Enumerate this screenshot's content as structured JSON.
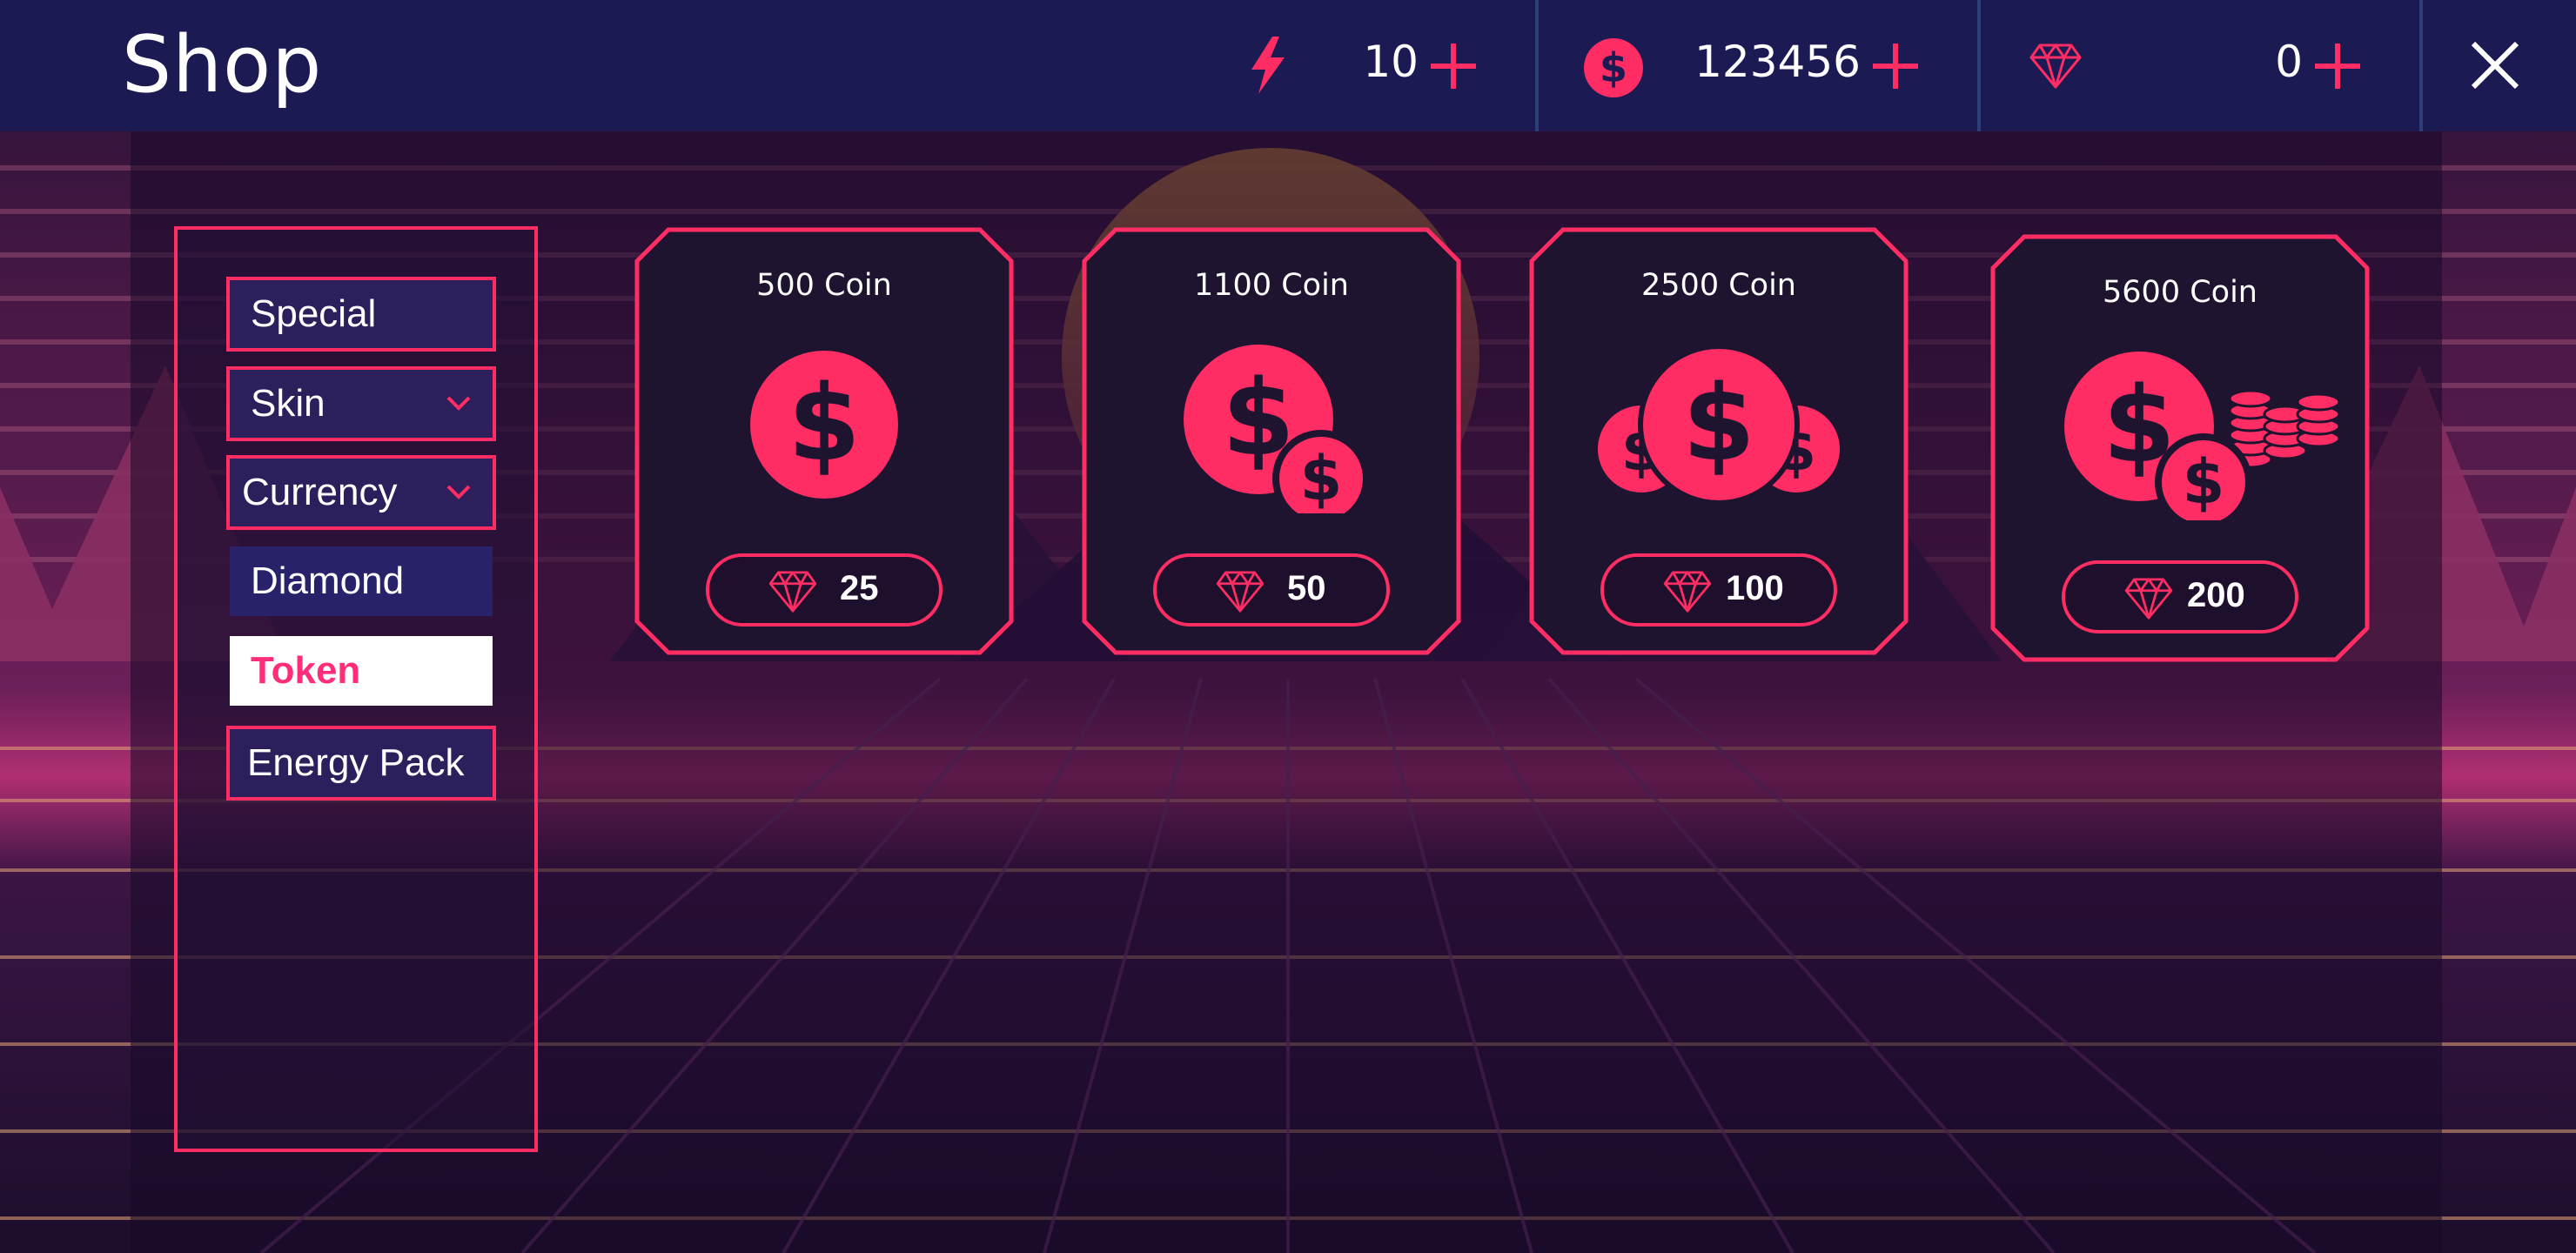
{
  "title": "Shop",
  "resources": [
    {
      "name": "energy",
      "icon": "lightning-icon",
      "value": "10"
    },
    {
      "name": "coins",
      "icon": "coin-icon",
      "value": "123456"
    },
    {
      "name": "diamonds",
      "icon": "diamond-icon",
      "value": "0"
    }
  ],
  "sidebar": {
    "items": [
      {
        "label": "Special"
      },
      {
        "label": "Skin",
        "expandable": true
      },
      {
        "label": "Currency",
        "expandable": true,
        "expanded": true
      },
      {
        "label": "Diamond",
        "sub": true
      },
      {
        "label": "Token",
        "sub": true,
        "selected": true
      },
      {
        "label": "Energy Pack"
      }
    ]
  },
  "products": [
    {
      "title": "500 Coin",
      "icon": "coin-icon",
      "price": "25",
      "price_icon": "diamond-icon"
    },
    {
      "title": "1100 Coin",
      "icon": "two-coins-icon",
      "price": "50",
      "price_icon": "diamond-icon"
    },
    {
      "title": "2500 Coin",
      "icon": "three-coins-icon",
      "price": "100",
      "price_icon": "diamond-icon"
    },
    {
      "title": "5600 Coin",
      "icon": "coin-pile-icon",
      "price": "200",
      "price_icon": "diamond-icon"
    }
  ],
  "colors": {
    "accent": "#ff2d63",
    "topbar": "#1b1a52",
    "panel": "#1f1430"
  }
}
